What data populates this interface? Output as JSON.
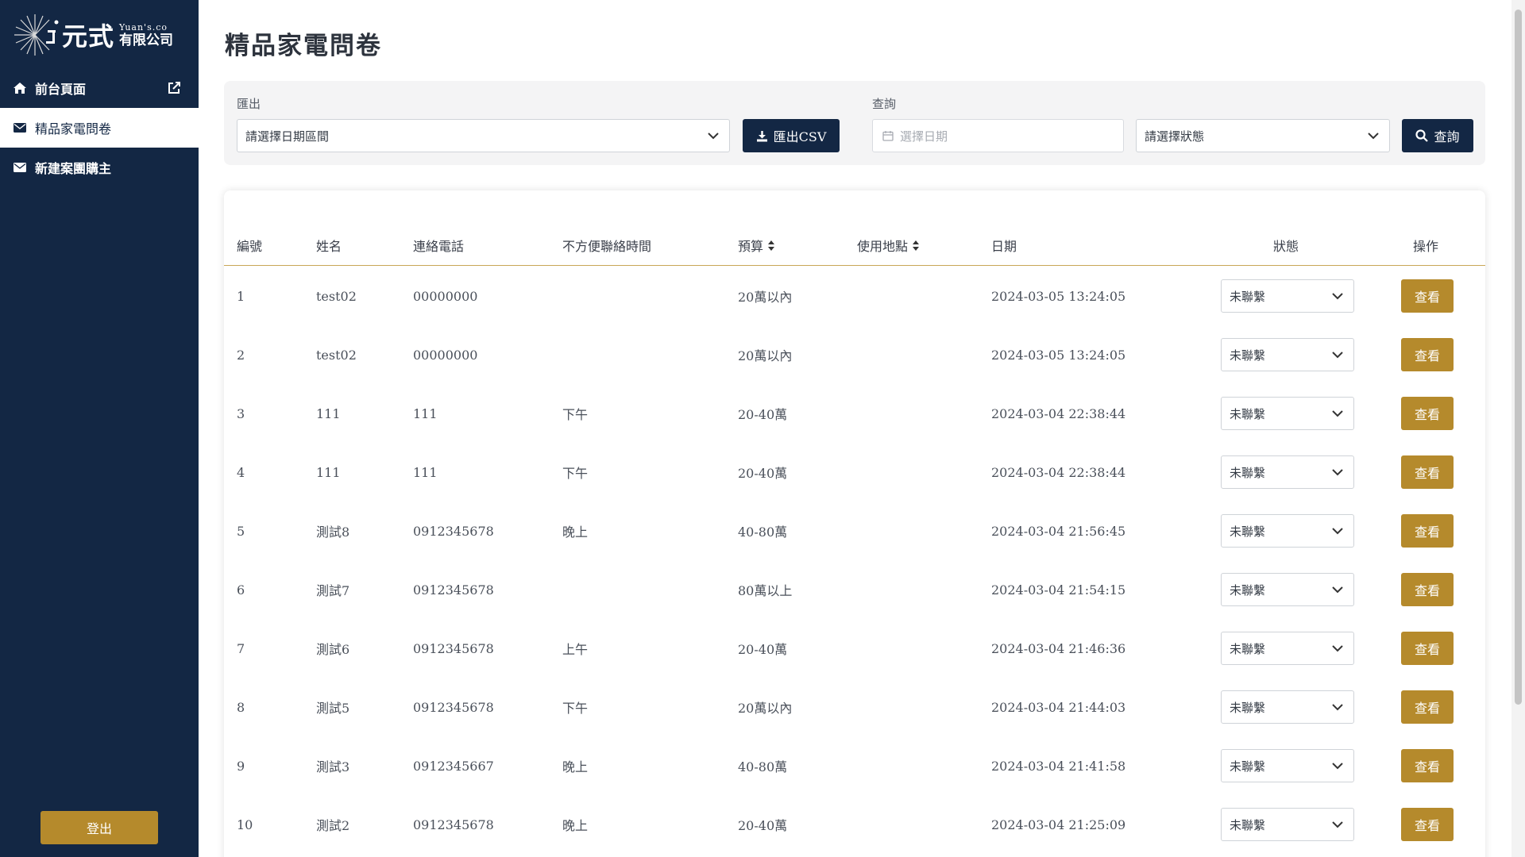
{
  "brand": {
    "name": "元式",
    "en": "Yuan's.co",
    "company": "有限公司"
  },
  "sidebar": {
    "items": [
      {
        "label": "前台頁面",
        "icon": "home-icon",
        "extra_icon": "external-link-icon"
      },
      {
        "label": "精品家電問卷",
        "icon": "envelope-icon"
      },
      {
        "label": "新建案團購主",
        "icon": "envelope-icon"
      }
    ],
    "active_index": 1,
    "logout_label": "登出"
  },
  "page": {
    "title": "精品家電問卷"
  },
  "filters": {
    "export_label": "匯出",
    "date_range_value": "請選擇日期區間",
    "export_button": "匯出CSV",
    "query_label": "查詢",
    "date_placeholder": "選擇日期",
    "status_value": "請選擇狀態",
    "query_button": "查詢"
  },
  "table": {
    "columns": [
      "編號",
      "姓名",
      "連絡電話",
      "不方便聯絡時間",
      "預算",
      "使用地點",
      "日期",
      "狀態",
      "操作"
    ],
    "sortable": [
      "預算",
      "使用地點"
    ],
    "view_label": "查看",
    "rows": [
      {
        "id": "1",
        "name": "test02",
        "phone": "00000000",
        "time": "",
        "budget": "20萬以內",
        "place": "",
        "date": "2024-03-05 13:24:05",
        "status": "未聯繫"
      },
      {
        "id": "2",
        "name": "test02",
        "phone": "00000000",
        "time": "",
        "budget": "20萬以內",
        "place": "",
        "date": "2024-03-05 13:24:05",
        "status": "未聯繫"
      },
      {
        "id": "3",
        "name": "111",
        "phone": "111",
        "time": "下午",
        "budget": "20-40萬",
        "place": "",
        "date": "2024-03-04 22:38:44",
        "status": "未聯繫"
      },
      {
        "id": "4",
        "name": "111",
        "phone": "111",
        "time": "下午",
        "budget": "20-40萬",
        "place": "",
        "date": "2024-03-04 22:38:44",
        "status": "未聯繫"
      },
      {
        "id": "5",
        "name": "測試8",
        "phone": "0912345678",
        "time": "晚上",
        "budget": "40-80萬",
        "place": "",
        "date": "2024-03-04 21:56:45",
        "status": "未聯繫"
      },
      {
        "id": "6",
        "name": "測試7",
        "phone": "0912345678",
        "time": "",
        "budget": "80萬以上",
        "place": "",
        "date": "2024-03-04 21:54:15",
        "status": "未聯繫"
      },
      {
        "id": "7",
        "name": "測試6",
        "phone": "0912345678",
        "time": "上午",
        "budget": "20-40萬",
        "place": "",
        "date": "2024-03-04 21:46:36",
        "status": "未聯繫"
      },
      {
        "id": "8",
        "name": "測試5",
        "phone": "0912345678",
        "time": "下午",
        "budget": "20萬以內",
        "place": "",
        "date": "2024-03-04 21:44:03",
        "status": "未聯繫"
      },
      {
        "id": "9",
        "name": "測試3",
        "phone": "0912345667",
        "time": "晚上",
        "budget": "40-80萬",
        "place": "",
        "date": "2024-03-04 21:41:58",
        "status": "未聯繫"
      },
      {
        "id": "10",
        "name": "測試2",
        "phone": "0912345678",
        "time": "晚上",
        "budget": "20-40萬",
        "place": "",
        "date": "2024-03-04 21:25:09",
        "status": "未聯繫"
      }
    ]
  },
  "colors": {
    "sidebar_bg": "#132744",
    "accent_gold": "#b58a2c",
    "button_dark": "#132744"
  }
}
